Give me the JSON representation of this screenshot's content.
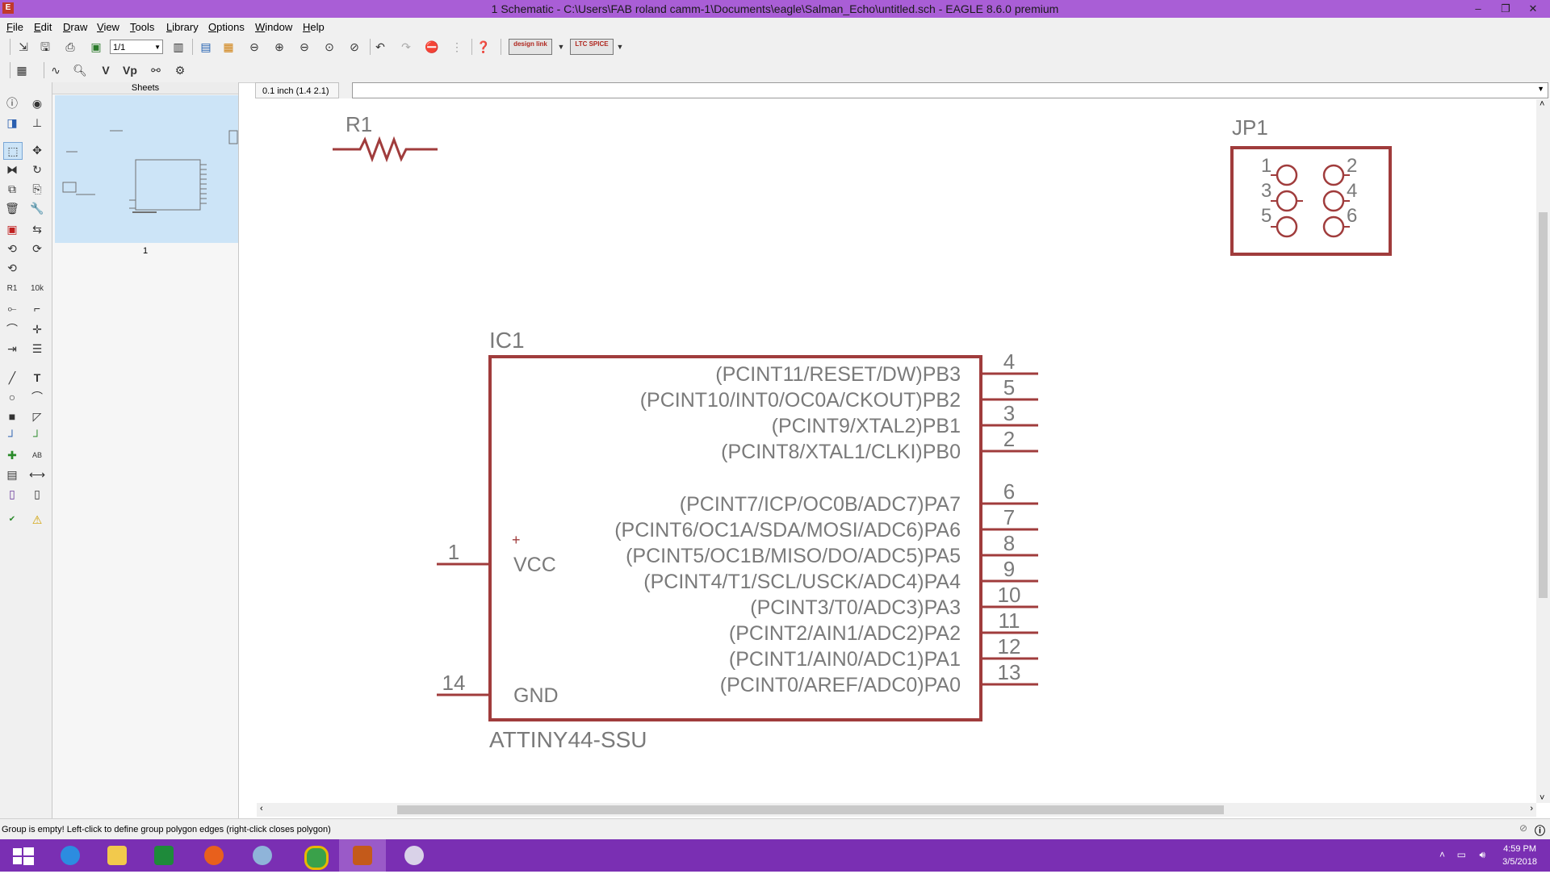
{
  "window": {
    "title": "1 Schematic - C:\\Users\\FAB roland camm-1\\Documents\\eagle\\Salman_Echo\\untitled.sch - EAGLE 8.6.0 premium",
    "controls": {
      "minimize": "–",
      "restore": "❐",
      "close": "✕"
    }
  },
  "menu": [
    "File",
    "Edit",
    "Draw",
    "View",
    "Tools",
    "Library",
    "Options",
    "Window",
    "Help"
  ],
  "toolbar": {
    "sheet_select": "1/1",
    "design_link": "design link",
    "ltspice": "LTC SPICE"
  },
  "sheets_panel": {
    "title": "Sheets",
    "sheet_number": "1"
  },
  "command": {
    "coordinate": "0.1 inch (1.4 2.1)",
    "input_value": ""
  },
  "schematic": {
    "r1": {
      "name": "R1"
    },
    "jp1": {
      "name": "JP1",
      "pins": [
        "1",
        "2",
        "3",
        "4",
        "5",
        "6"
      ]
    },
    "ic1": {
      "name": "IC1",
      "value": "ATTINY44-SSU",
      "right_pins": [
        {
          "num": "4",
          "label": "(PCINT11/RESET/DW)PB3"
        },
        {
          "num": "5",
          "label": "(PCINT10/INT0/OC0A/CKOUT)PB2"
        },
        {
          "num": "3",
          "label": "(PCINT9/XTAL2)PB1"
        },
        {
          "num": "2",
          "label": "(PCINT8/XTAL1/CLKI)PB0"
        },
        {
          "num": "6",
          "label": "(PCINT7/ICP/OC0B/ADC7)PA7"
        },
        {
          "num": "7",
          "label": "(PCINT6/OC1A/SDA/MOSI/ADC6)PA6"
        },
        {
          "num": "8",
          "label": "(PCINT5/OC1B/MISO/DO/ADC5)PA5"
        },
        {
          "num": "9",
          "label": "(PCINT4/T1/SCL/USCK/ADC4)PA4"
        },
        {
          "num": "10",
          "label": "(PCINT3/T0/ADC3)PA3"
        },
        {
          "num": "11",
          "label": "(PCINT2/AIN1/ADC2)PA2"
        },
        {
          "num": "12",
          "label": "(PCINT1/AIN0/ADC1)PA1"
        },
        {
          "num": "13",
          "label": "(PCINT0/AREF/ADC0)PA0"
        }
      ],
      "left_pins": [
        {
          "num": "1",
          "label": "VCC"
        },
        {
          "num": "14",
          "label": "GND"
        }
      ]
    }
  },
  "status": {
    "message": "Group is empty! Left-click to define group polygon edges (right-click closes polygon)"
  },
  "taskbar": {
    "time": "4:59 PM",
    "date": "3/5/2018"
  },
  "colors": {
    "titlebar": "#a95ed6",
    "taskbar": "#7a2fb3",
    "schematic_symbol": "#a03c3c",
    "schematic_text": "#7a7a7a",
    "selection": "#cce4f7"
  }
}
